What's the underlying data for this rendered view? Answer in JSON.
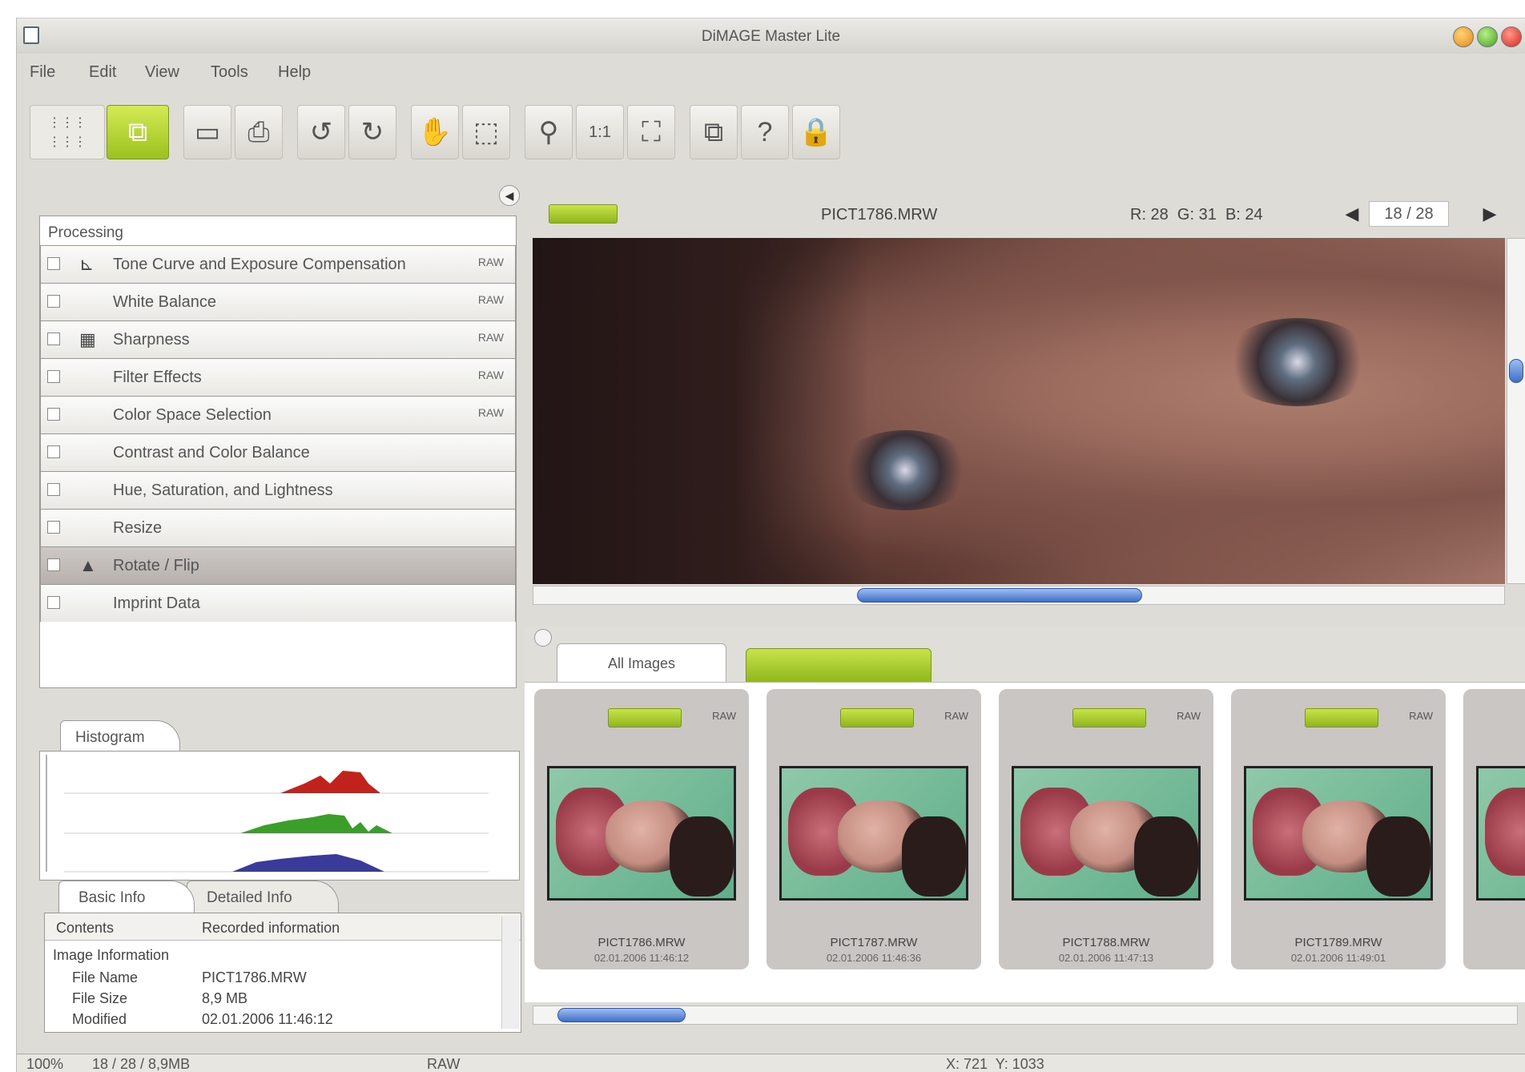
{
  "window": {
    "title": "DiMAGE Master Lite"
  },
  "menu": [
    "File",
    "Edit",
    "View",
    "Tools",
    "Help"
  ],
  "viewer": {
    "filename": "PICT1786.MRW",
    "rgb": "R: 28  G: 31  B: 24",
    "counter": "18 / 28"
  },
  "processing": {
    "title": "Processing",
    "items": [
      {
        "label": "Tone Curve and Exposure Compensation",
        "raw": "RAW",
        "icon": "tone-curve-icon"
      },
      {
        "label": "White Balance",
        "raw": "RAW",
        "icon": ""
      },
      {
        "label": "Sharpness",
        "raw": "RAW",
        "icon": "sharpness-icon"
      },
      {
        "label": "Filter Effects",
        "raw": "RAW",
        "icon": ""
      },
      {
        "label": "Color Space Selection",
        "raw": "RAW",
        "icon": ""
      },
      {
        "label": "Contrast and Color Balance",
        "raw": "",
        "icon": ""
      },
      {
        "label": "Hue, Saturation, and Lightness",
        "raw": "",
        "icon": ""
      },
      {
        "label": "Resize",
        "raw": "",
        "icon": ""
      },
      {
        "label": "Rotate / Flip",
        "raw": "",
        "icon": "rotate-flip-icon"
      },
      {
        "label": "Imprint Data",
        "raw": "",
        "icon": ""
      }
    ]
  },
  "histogram": {
    "tab": "Histogram"
  },
  "info": {
    "tabs": [
      "Basic Info",
      "Detailed Info"
    ],
    "columns": [
      "Contents",
      "Recorded information"
    ],
    "section": "Image Information",
    "rows": [
      {
        "k": "File Name",
        "v": "PICT1786.MRW"
      },
      {
        "k": "File Size",
        "v": "8,9 MB"
      },
      {
        "k": "Modified",
        "v": "02.01.2006 11:46:12"
      }
    ]
  },
  "browser": {
    "tab_all": "All Images"
  },
  "thumbnails": [
    {
      "name": "PICT1786.MRW",
      "date": "02.01.2006 11:46:12",
      "raw": "RAW"
    },
    {
      "name": "PICT1787.MRW",
      "date": "02.01.2006 11:46:36",
      "raw": "RAW"
    },
    {
      "name": "PICT1788.MRW",
      "date": "02.01.2006 11:47:13",
      "raw": "RAW"
    },
    {
      "name": "PICT1789.MRW",
      "date": "02.01.2006 11:49:01",
      "raw": "RAW"
    }
  ],
  "status": {
    "zoom": "100%",
    "count": "18 / 28 / 8,9MB",
    "format": "RAW",
    "coords": "X: 721  Y: 1033"
  },
  "colors": {
    "accent_green": "#9bc21e",
    "selection": "#b9b3b0",
    "scroll_blue": "#3e6fc8"
  }
}
